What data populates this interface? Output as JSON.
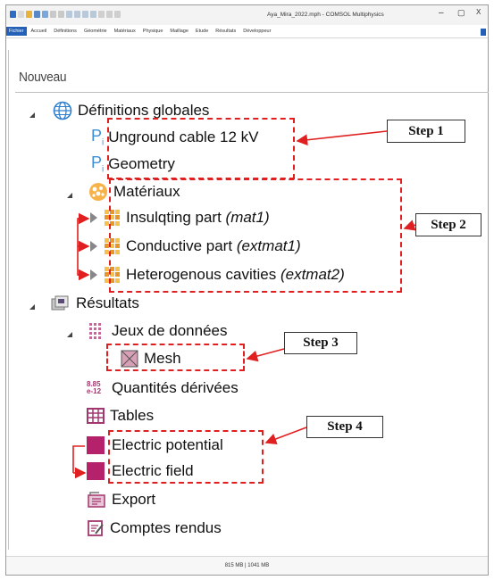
{
  "window": {
    "title": "Aya_Mira_2022.mph - COMSOL Multiphysics",
    "controls": [
      "–",
      "▢",
      "X"
    ]
  },
  "menubar": {
    "tabs": [
      "Fichier",
      "Accueil",
      "Définitions",
      "Géométrie",
      "Matériaux",
      "Physique",
      "Maillage",
      "Etude",
      "Résultats",
      "Développeur"
    ]
  },
  "model_builder": {
    "header": "Nouveau",
    "definitions": {
      "label": "Définitions globales",
      "items": [
        "Unground cable 12 kV",
        "Geometry"
      ]
    },
    "materials": {
      "label": "Matériaux",
      "items": [
        {
          "name": "Insulqting part",
          "tag": "(mat1)"
        },
        {
          "name": "Conductive part",
          "tag": "(extmat1)"
        },
        {
          "name": "Heterogenous cavities",
          "tag": "(extmat2)"
        }
      ]
    },
    "results": {
      "label": "Résultats",
      "datasets_label": "Jeux de données",
      "mesh_label": "Mesh",
      "derived_label": "Quantités dérivées",
      "derived_icon_text": "8.85\ne-12",
      "tables_label": "Tables",
      "plots": [
        "Electric potential",
        "Electric field"
      ],
      "export_label": "Export",
      "reports_label": "Comptes rendus"
    }
  },
  "annotations": {
    "steps": [
      "Step 1",
      "Step 2",
      "Step 3",
      "Step 4"
    ],
    "highlight_color": "#e02020"
  },
  "statusbar": {
    "memory": "815 MB | 1041 MB"
  },
  "colors": {
    "accent": "#2460b5",
    "plot_icon": "#b5216b",
    "material_icon": "#e8962a"
  }
}
